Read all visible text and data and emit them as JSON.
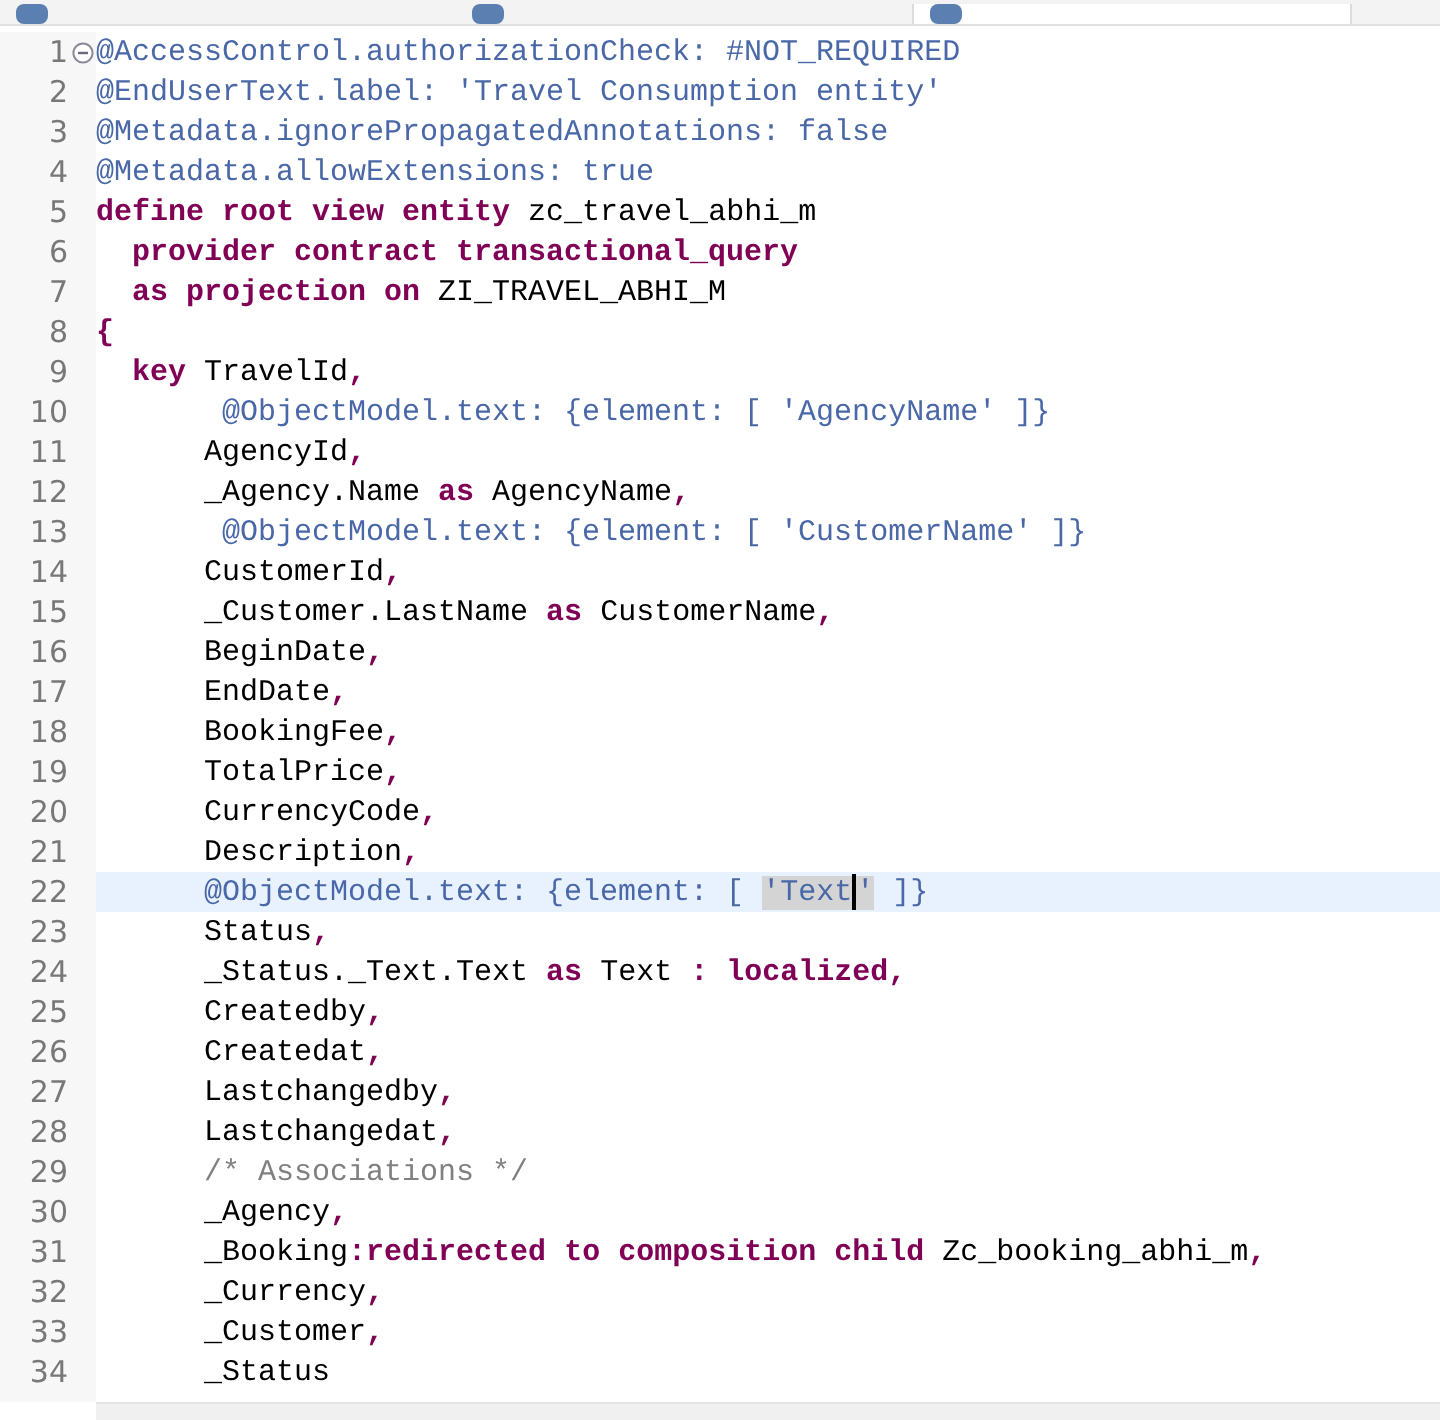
{
  "tabs": [
    {
      "selected": false
    },
    {
      "selected": false
    },
    {
      "selected": true
    }
  ],
  "editor": {
    "lines": [
      {
        "number": "1",
        "foldable": true,
        "current": false,
        "tokens": [
          {
            "kind": "annotation",
            "text": "@AccessControl.authorizationCheck: #NOT_REQUIRED"
          }
        ]
      },
      {
        "number": "2",
        "foldable": false,
        "current": false,
        "tokens": [
          {
            "kind": "annotation",
            "text": "@EndUserText.label: 'Travel Consumption entity'"
          }
        ]
      },
      {
        "number": "3",
        "foldable": false,
        "current": false,
        "tokens": [
          {
            "kind": "annotation",
            "text": "@Metadata.ignorePropagatedAnnotations: false"
          }
        ]
      },
      {
        "number": "4",
        "foldable": false,
        "current": false,
        "tokens": [
          {
            "kind": "annotation",
            "text": "@Metadata.allowExtensions: true"
          }
        ]
      },
      {
        "number": "5",
        "foldable": false,
        "current": false,
        "tokens": [
          {
            "kind": "keyword",
            "text": "define root view entity"
          },
          {
            "kind": "plain",
            "text": " zc_travel_abhi_m"
          }
        ]
      },
      {
        "number": "6",
        "foldable": false,
        "current": false,
        "tokens": [
          {
            "kind": "keyword",
            "text": "  provider contract transactional_query"
          }
        ]
      },
      {
        "number": "7",
        "foldable": false,
        "current": false,
        "tokens": [
          {
            "kind": "keyword",
            "text": "  as projection on"
          },
          {
            "kind": "plain",
            "text": " ZI_TRAVEL_ABHI_M"
          }
        ]
      },
      {
        "number": "8",
        "foldable": false,
        "current": false,
        "tokens": [
          {
            "kind": "keyword",
            "text": "{"
          }
        ]
      },
      {
        "number": "9",
        "foldable": false,
        "current": false,
        "tokens": [
          {
            "kind": "keyword",
            "text": "  key"
          },
          {
            "kind": "plain",
            "text": " TravelId"
          },
          {
            "kind": "punct",
            "text": ","
          }
        ]
      },
      {
        "number": "10",
        "foldable": false,
        "current": false,
        "tokens": [
          {
            "kind": "annotation",
            "text": "       @ObjectModel.text: {element: [ 'AgencyName' ]}"
          }
        ]
      },
      {
        "number": "11",
        "foldable": false,
        "current": false,
        "tokens": [
          {
            "kind": "plain",
            "text": "      AgencyId"
          },
          {
            "kind": "punct",
            "text": ","
          }
        ]
      },
      {
        "number": "12",
        "foldable": false,
        "current": false,
        "tokens": [
          {
            "kind": "plain",
            "text": "      _Agency.Name "
          },
          {
            "kind": "keyword",
            "text": "as"
          },
          {
            "kind": "plain",
            "text": " AgencyName"
          },
          {
            "kind": "punct",
            "text": ","
          }
        ]
      },
      {
        "number": "13",
        "foldable": false,
        "current": false,
        "tokens": [
          {
            "kind": "annotation",
            "text": "       @ObjectModel.text: {element: [ 'CustomerName' ]}"
          }
        ]
      },
      {
        "number": "14",
        "foldable": false,
        "current": false,
        "tokens": [
          {
            "kind": "plain",
            "text": "      CustomerId"
          },
          {
            "kind": "punct",
            "text": ","
          }
        ]
      },
      {
        "number": "15",
        "foldable": false,
        "current": false,
        "tokens": [
          {
            "kind": "plain",
            "text": "      _Customer.LastName "
          },
          {
            "kind": "keyword",
            "text": "as"
          },
          {
            "kind": "plain",
            "text": " CustomerName"
          },
          {
            "kind": "punct",
            "text": ","
          }
        ]
      },
      {
        "number": "16",
        "foldable": false,
        "current": false,
        "tokens": [
          {
            "kind": "plain",
            "text": "      BeginDate"
          },
          {
            "kind": "punct",
            "text": ","
          }
        ]
      },
      {
        "number": "17",
        "foldable": false,
        "current": false,
        "tokens": [
          {
            "kind": "plain",
            "text": "      EndDate"
          },
          {
            "kind": "punct",
            "text": ","
          }
        ]
      },
      {
        "number": "18",
        "foldable": false,
        "current": false,
        "tokens": [
          {
            "kind": "plain",
            "text": "      BookingFee"
          },
          {
            "kind": "punct",
            "text": ","
          }
        ]
      },
      {
        "number": "19",
        "foldable": false,
        "current": false,
        "tokens": [
          {
            "kind": "plain",
            "text": "      TotalPrice"
          },
          {
            "kind": "punct",
            "text": ","
          }
        ]
      },
      {
        "number": "20",
        "foldable": false,
        "current": false,
        "tokens": [
          {
            "kind": "plain",
            "text": "      CurrencyCode"
          },
          {
            "kind": "punct",
            "text": ","
          }
        ]
      },
      {
        "number": "21",
        "foldable": false,
        "current": false,
        "tokens": [
          {
            "kind": "plain",
            "text": "      Description"
          },
          {
            "kind": "punct",
            "text": ","
          }
        ]
      },
      {
        "number": "22",
        "foldable": false,
        "current": true,
        "tokens": [
          {
            "kind": "annotation",
            "text": "      @ObjectModel.text: {element: [ "
          },
          {
            "kind": "match",
            "text": "'Text"
          },
          {
            "kind": "caret"
          },
          {
            "kind": "match",
            "text": "'"
          },
          {
            "kind": "annotation",
            "text": " ]}"
          }
        ]
      },
      {
        "number": "23",
        "foldable": false,
        "current": false,
        "tokens": [
          {
            "kind": "plain",
            "text": "      Status"
          },
          {
            "kind": "punct",
            "text": ","
          }
        ]
      },
      {
        "number": "24",
        "foldable": false,
        "current": false,
        "tokens": [
          {
            "kind": "plain",
            "text": "      _Status._Text.Text "
          },
          {
            "kind": "keyword",
            "text": "as"
          },
          {
            "kind": "plain",
            "text": " Text "
          },
          {
            "kind": "punct",
            "text": ":"
          },
          {
            "kind": "keyword",
            "text": " localized"
          },
          {
            "kind": "punct",
            "text": ","
          }
        ]
      },
      {
        "number": "25",
        "foldable": false,
        "current": false,
        "tokens": [
          {
            "kind": "plain",
            "text": "      Createdby"
          },
          {
            "kind": "punct",
            "text": ","
          }
        ]
      },
      {
        "number": "26",
        "foldable": false,
        "current": false,
        "tokens": [
          {
            "kind": "plain",
            "text": "      Createdat"
          },
          {
            "kind": "punct",
            "text": ","
          }
        ]
      },
      {
        "number": "27",
        "foldable": false,
        "current": false,
        "tokens": [
          {
            "kind": "plain",
            "text": "      Lastchangedby"
          },
          {
            "kind": "punct",
            "text": ","
          }
        ]
      },
      {
        "number": "28",
        "foldable": false,
        "current": false,
        "tokens": [
          {
            "kind": "plain",
            "text": "      Lastchangedat"
          },
          {
            "kind": "punct",
            "text": ","
          }
        ]
      },
      {
        "number": "29",
        "foldable": false,
        "current": false,
        "tokens": [
          {
            "kind": "comment",
            "text": "      /* Associations */"
          }
        ]
      },
      {
        "number": "30",
        "foldable": false,
        "current": false,
        "tokens": [
          {
            "kind": "plain",
            "text": "      _Agency"
          },
          {
            "kind": "punct",
            "text": ","
          }
        ]
      },
      {
        "number": "31",
        "foldable": false,
        "current": false,
        "tokens": [
          {
            "kind": "plain",
            "text": "      _Booking"
          },
          {
            "kind": "punct",
            "text": ":"
          },
          {
            "kind": "keyword",
            "text": "redirected to composition child"
          },
          {
            "kind": "plain",
            "text": " Zc_booking_abhi_m"
          },
          {
            "kind": "punct",
            "text": ","
          }
        ]
      },
      {
        "number": "32",
        "foldable": false,
        "current": false,
        "tokens": [
          {
            "kind": "plain",
            "text": "      _Currency"
          },
          {
            "kind": "punct",
            "text": ","
          }
        ]
      },
      {
        "number": "33",
        "foldable": false,
        "current": false,
        "tokens": [
          {
            "kind": "plain",
            "text": "      _Customer"
          },
          {
            "kind": "punct",
            "text": ","
          }
        ]
      },
      {
        "number": "34",
        "foldable": false,
        "current": false,
        "tokens": [
          {
            "kind": "plain",
            "text": "      _Status"
          }
        ]
      }
    ]
  }
}
